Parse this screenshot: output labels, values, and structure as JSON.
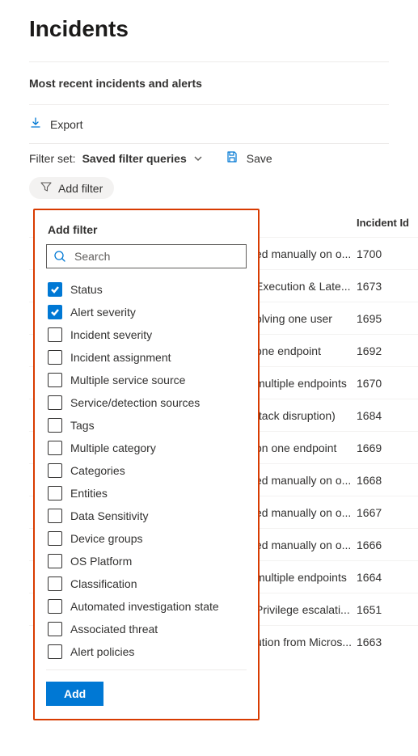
{
  "header": {
    "title": "Incidents",
    "subtitle": "Most recent incidents and alerts"
  },
  "toolbar": {
    "export_label": "Export",
    "filter_set_label": "Filter set:",
    "filter_set_value": "Saved filter queries",
    "save_label": "Save",
    "add_filter_label": "Add filter"
  },
  "popover": {
    "title": "Add filter",
    "search_placeholder": "Search",
    "add_button": "Add",
    "options": [
      {
        "label": "Status",
        "checked": true
      },
      {
        "label": "Alert severity",
        "checked": true
      },
      {
        "label": "Incident severity",
        "checked": false
      },
      {
        "label": "Incident assignment",
        "checked": false
      },
      {
        "label": "Multiple service source",
        "checked": false
      },
      {
        "label": "Service/detection sources",
        "checked": false
      },
      {
        "label": "Tags",
        "checked": false
      },
      {
        "label": "Multiple category",
        "checked": false
      },
      {
        "label": "Categories",
        "checked": false
      },
      {
        "label": "Entities",
        "checked": false
      },
      {
        "label": "Data Sensitivity",
        "checked": false
      },
      {
        "label": "Device groups",
        "checked": false
      },
      {
        "label": "OS Platform",
        "checked": false
      },
      {
        "label": "Classification",
        "checked": false
      },
      {
        "label": "Automated investigation state",
        "checked": false
      },
      {
        "label": "Associated threat",
        "checked": false
      },
      {
        "label": "Alert policies",
        "checked": false
      }
    ]
  },
  "table": {
    "columns": {
      "name": "",
      "id": "Incident Id"
    },
    "rows": [
      {
        "name": "ed manually on o...",
        "id": "1700"
      },
      {
        "name": "Execution & Late...",
        "id": "1673"
      },
      {
        "name": "olving one user",
        "id": "1695"
      },
      {
        "name": "one endpoint",
        "id": "1692"
      },
      {
        "name": "multiple endpoints",
        "id": "1670"
      },
      {
        "name": "ttack disruption)",
        "id": "1684"
      },
      {
        "name": "on one endpoint",
        "id": "1669"
      },
      {
        "name": "ed manually on o...",
        "id": "1668"
      },
      {
        "name": "ed manually on o...",
        "id": "1667"
      },
      {
        "name": "ed manually on o...",
        "id": "1666"
      },
      {
        "name": "multiple endpoints",
        "id": "1664"
      },
      {
        "name": "Privilege escalati...",
        "id": "1651"
      },
      {
        "name": "ution from Micros...",
        "id": "1663"
      }
    ]
  }
}
